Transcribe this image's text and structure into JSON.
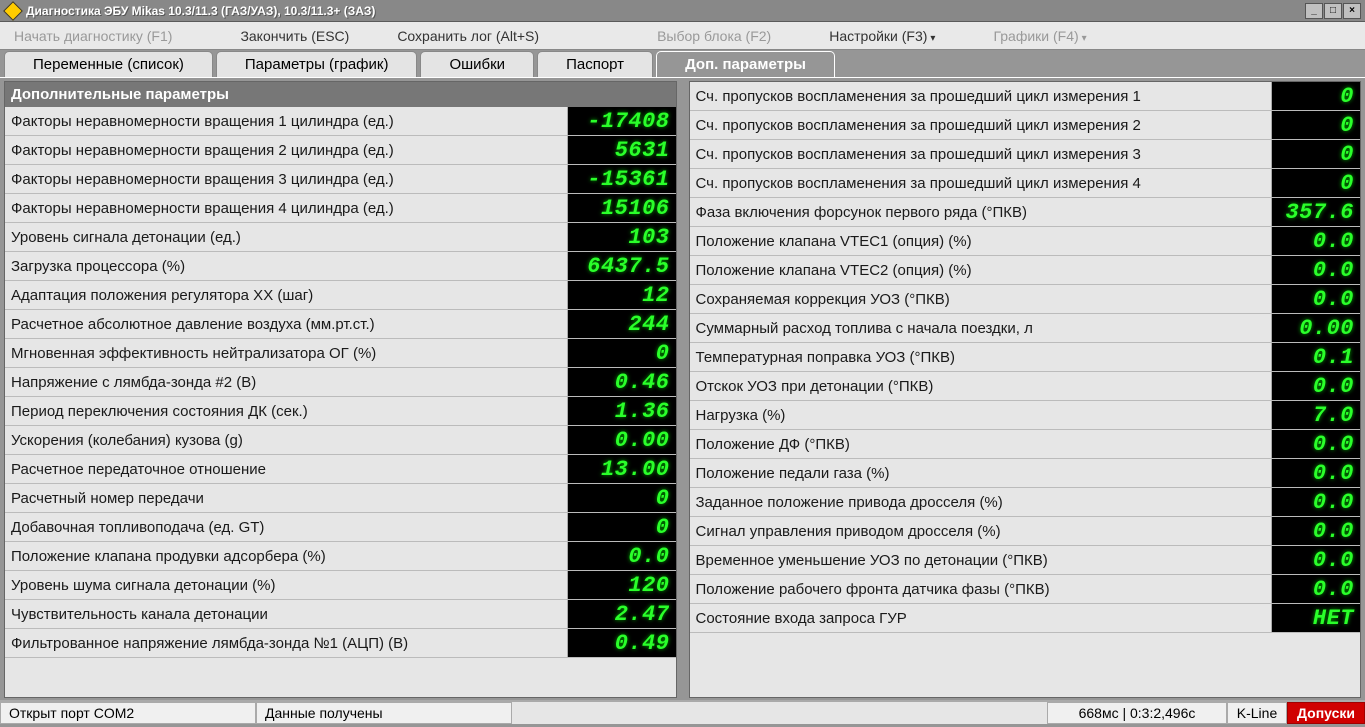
{
  "window": {
    "title": "Диагностика ЭБУ Mikas 10.3/11.3 (ГАЗ/УАЗ), 10.3/11.3+ (ЗАЗ)",
    "minimize": "_",
    "maximize": "□",
    "close": "×"
  },
  "toolbar": {
    "start": "Начать диагностику (F1)",
    "end": "Закончить (ESC)",
    "save": "Сохранить лог (Alt+S)",
    "block": "Выбор блока (F2)",
    "settings": "Настройки (F3)",
    "charts": "Графики (F4)"
  },
  "tabs": {
    "t0": "Переменные (список)",
    "t1": "Параметры (график)",
    "t2": "Ошибки",
    "t3": "Паспорт",
    "t4": "Доп. параметры"
  },
  "left": {
    "header": "Дополнительные параметры",
    "rows": [
      {
        "label": "Факторы неравномерности вращения 1 цилиндра (ед.)",
        "value": "-17408"
      },
      {
        "label": "Факторы неравномерности вращения 2 цилиндра (ед.)",
        "value": "5631"
      },
      {
        "label": "Факторы неравномерности вращения 3 цилиндра (ед.)",
        "value": "-15361"
      },
      {
        "label": "Факторы неравномерности вращения 4 цилиндра (ед.)",
        "value": "15106"
      },
      {
        "label": "Уровень сигнала детонации (ед.)",
        "value": "103"
      },
      {
        "label": "Загрузка процессора (%)",
        "value": "6437.5"
      },
      {
        "label": "Адаптация положения регулятора ХХ (шаг)",
        "value": "12"
      },
      {
        "label": "Расчетное абсолютное давление воздуха (мм.рт.ст.)",
        "value": "244"
      },
      {
        "label": "Мгновенная эффективность нейтрализатора ОГ (%)",
        "value": "0"
      },
      {
        "label": "Напряжение с лямбда-зонда #2 (В)",
        "value": "0.46"
      },
      {
        "label": "Период переключения состояния ДК (сек.)",
        "value": "1.36"
      },
      {
        "label": "Ускорения (колебания) кузова (g)",
        "value": "0.00"
      },
      {
        "label": "Расчетное передаточное отношение",
        "value": "13.00"
      },
      {
        "label": "Расчетный номер передачи",
        "value": "0"
      },
      {
        "label": "Добавочная топливоподача (ед. GT)",
        "value": "0"
      },
      {
        "label": "Положение клапана продувки адсорбера (%)",
        "value": "0.0"
      },
      {
        "label": "Уровень шума сигнала детонации (%)",
        "value": "120"
      },
      {
        "label": "Чувствительность канала детонации",
        "value": "2.47"
      },
      {
        "label": "Фильтрованное напряжение лямбда-зонда №1 (АЦП) (В)",
        "value": "0.49"
      }
    ]
  },
  "right": {
    "rows": [
      {
        "label": "Сч. пропусков воспламенения за прошедший цикл измерения 1",
        "value": "0"
      },
      {
        "label": "Сч. пропусков воспламенения за прошедший цикл измерения 2",
        "value": "0"
      },
      {
        "label": "Сч. пропусков воспламенения за прошедший цикл измерения 3",
        "value": "0"
      },
      {
        "label": "Сч. пропусков воспламенения за прошедший цикл измерения 4",
        "value": "0"
      },
      {
        "label": "Фаза включения форсунок первого ряда (°ПКВ)",
        "value": "357.6"
      },
      {
        "label": "Положение клапана VTEC1 (опция) (%)",
        "value": "0.0"
      },
      {
        "label": "Положение клапана VTEC2 (опция) (%)",
        "value": "0.0"
      },
      {
        "label": "Сохраняемая коррекция УОЗ (°ПКВ)",
        "value": "0.0"
      },
      {
        "label": "Суммарный расход топлива с начала поездки, л",
        "value": "0.00"
      },
      {
        "label": "Температурная поправка УОЗ (°ПКВ)",
        "value": "0.1"
      },
      {
        "label": "Отскок УОЗ при детонации (°ПКВ)",
        "value": "0.0"
      },
      {
        "label": "Нагрузка (%)",
        "value": "7.0"
      },
      {
        "label": "Положение ДФ (°ПКВ)",
        "value": "0.0"
      },
      {
        "label": "Положение педали газа (%)",
        "value": "0.0"
      },
      {
        "label": "Заданное положение привода дросселя (%)",
        "value": "0.0"
      },
      {
        "label": "Сигнал управления приводом  дросселя (%)",
        "value": "0.0"
      },
      {
        "label": "Временное уменьшение УОЗ по детонации (°ПКВ)",
        "value": "0.0"
      },
      {
        "label": "Положение рабочего фронта датчика фазы (°ПКВ)",
        "value": "0.0"
      },
      {
        "label": "Состояние входа запроса ГУР",
        "value": "НЕТ"
      }
    ]
  },
  "status": {
    "port": "Открыт порт COM2",
    "data": "Данные получены",
    "timing": "668мс | 0:3:2,496с",
    "kline": "K-Line",
    "admit": "Допуски"
  }
}
